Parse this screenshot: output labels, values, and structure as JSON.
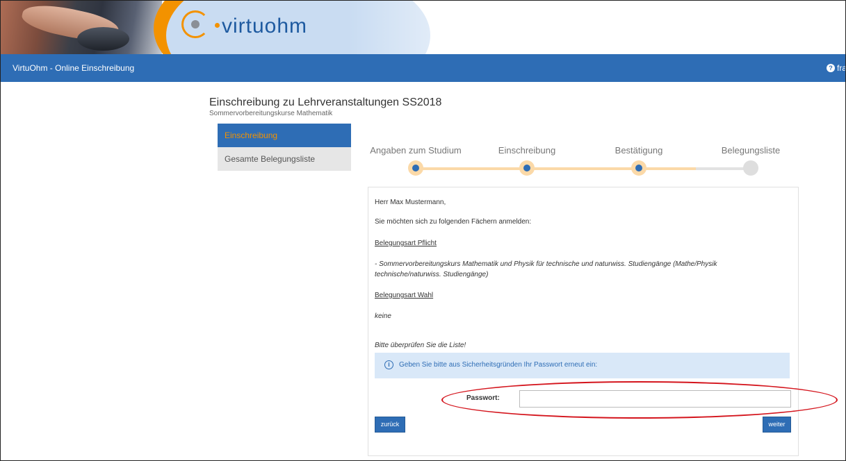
{
  "header": {
    "logo_text": "virtuohm",
    "nav_title": "VirtuOhm - Online Einschreibung",
    "help_label": "frag",
    "help_icon": "question-circle-icon"
  },
  "page": {
    "title": "Einschreibung zu Lehrveranstaltungen SS2018",
    "subtitle": "Sommervorbereitungskurse Mathematik"
  },
  "sidebar": {
    "items": [
      {
        "label": "Einschreibung",
        "active": true
      },
      {
        "label": "Gesamte Belegungsliste",
        "active": false
      }
    ]
  },
  "stepper": {
    "steps": [
      {
        "label": "Angaben zum Studium",
        "done": true
      },
      {
        "label": "Einschreibung",
        "done": true
      },
      {
        "label": "Bestätigung",
        "done": true
      },
      {
        "label": "Belegungsliste",
        "done": false
      }
    ]
  },
  "content": {
    "greeting": "Herr Max Mustermann,",
    "intro": "Sie möchten sich zu folgenden Fächern anmelden:",
    "section_required": "Belegungsart Pflicht",
    "required_line1": "- Sommervorbereitungskurs Mathematik und Physik für technische und naturwiss. Studiengänge (Mathe/Physik",
    "required_line2": "technische/naturwiss. Studiengänge)",
    "section_elective": "Belegungsart Wahl",
    "elective_none": "keine",
    "check_note": "Bitte überprüfen Sie die Liste!",
    "info_message": "Geben Sie bitte aus Sicherheitsgründen Ihr Passwort erneut ein:",
    "password_label": "Passwort:",
    "password_value": "",
    "back_button": "zurück",
    "next_button": "weiter"
  },
  "colors": {
    "primary": "#2e6db5",
    "accent_orange": "#f39200",
    "step_done": "#fbd9a8",
    "annotation_red": "#d4141c"
  }
}
